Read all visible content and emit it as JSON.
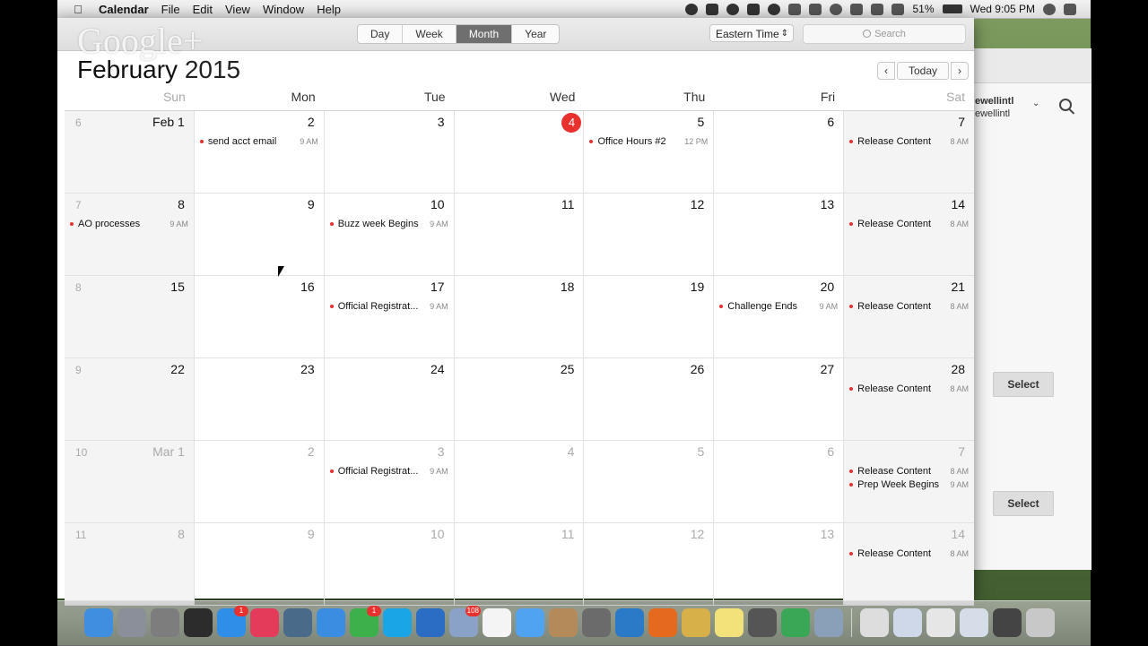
{
  "menubar": {
    "app_name": "Calendar",
    "menus": [
      "File",
      "Edit",
      "View",
      "Window",
      "Help"
    ],
    "battery": "51%",
    "clock": "Wed 9:05 PM"
  },
  "watermark": "Google+",
  "toolbar": {
    "views": [
      "Day",
      "Week",
      "Month",
      "Year"
    ],
    "active_view": "Month",
    "timezone": "Eastern Time",
    "search_placeholder": "Search"
  },
  "title": {
    "month": "February",
    "year": "2015"
  },
  "nav": {
    "prev": "‹",
    "today": "Today",
    "next": "›"
  },
  "weekdays": [
    "Sun",
    "Mon",
    "Tue",
    "Wed",
    "Thu",
    "Fri",
    "Sat"
  ],
  "weeks": [
    {
      "weeknum": "6",
      "days": [
        {
          "label": "Feb 1",
          "dim": false,
          "events": []
        },
        {
          "label": "2",
          "dim": false,
          "events": [
            {
              "title": "send acct email",
              "time": "9 AM"
            }
          ]
        },
        {
          "label": "3",
          "dim": false,
          "events": []
        },
        {
          "label": "4",
          "dim": false,
          "today": true,
          "events": []
        },
        {
          "label": "5",
          "dim": false,
          "events": [
            {
              "title": "Office Hours #2",
              "time": "12 PM"
            }
          ]
        },
        {
          "label": "6",
          "dim": false,
          "events": []
        },
        {
          "label": "7",
          "dim": false,
          "events": [
            {
              "title": "Release Content",
              "time": "8 AM"
            }
          ]
        }
      ]
    },
    {
      "weeknum": "7",
      "days": [
        {
          "label": "8",
          "dim": false,
          "events": [
            {
              "title": "AO processes",
              "time": "9 AM"
            }
          ]
        },
        {
          "label": "9",
          "dim": false,
          "events": []
        },
        {
          "label": "10",
          "dim": false,
          "events": [
            {
              "title": "Buzz week Begins",
              "time": "9 AM"
            }
          ]
        },
        {
          "label": "11",
          "dim": false,
          "events": []
        },
        {
          "label": "12",
          "dim": false,
          "events": []
        },
        {
          "label": "13",
          "dim": false,
          "events": []
        },
        {
          "label": "14",
          "dim": false,
          "events": [
            {
              "title": "Release Content",
              "time": "8 AM"
            }
          ]
        }
      ]
    },
    {
      "weeknum": "8",
      "days": [
        {
          "label": "15",
          "dim": false,
          "events": []
        },
        {
          "label": "16",
          "dim": false,
          "events": []
        },
        {
          "label": "17",
          "dim": false,
          "events": [
            {
              "title": "Official Registrat...",
              "time": "9 AM"
            }
          ]
        },
        {
          "label": "18",
          "dim": false,
          "events": []
        },
        {
          "label": "19",
          "dim": false,
          "events": []
        },
        {
          "label": "20",
          "dim": false,
          "events": [
            {
              "title": "Challenge Ends",
              "time": "9 AM"
            }
          ]
        },
        {
          "label": "21",
          "dim": false,
          "events": [
            {
              "title": "Release Content",
              "time": "8 AM"
            }
          ]
        }
      ]
    },
    {
      "weeknum": "9",
      "days": [
        {
          "label": "22",
          "dim": false,
          "events": []
        },
        {
          "label": "23",
          "dim": false,
          "events": []
        },
        {
          "label": "24",
          "dim": false,
          "events": []
        },
        {
          "label": "25",
          "dim": false,
          "events": []
        },
        {
          "label": "26",
          "dim": false,
          "events": []
        },
        {
          "label": "27",
          "dim": false,
          "events": []
        },
        {
          "label": "28",
          "dim": false,
          "events": [
            {
              "title": "Release Content",
              "time": "8 AM"
            }
          ]
        }
      ]
    },
    {
      "weeknum": "10",
      "days": [
        {
          "label": "Mar 1",
          "dim": true,
          "events": []
        },
        {
          "label": "2",
          "dim": true,
          "events": []
        },
        {
          "label": "3",
          "dim": true,
          "events": [
            {
              "title": "Official Registrat...",
              "time": "9 AM"
            }
          ]
        },
        {
          "label": "4",
          "dim": true,
          "events": []
        },
        {
          "label": "5",
          "dim": true,
          "events": []
        },
        {
          "label": "6",
          "dim": true,
          "events": []
        },
        {
          "label": "7",
          "dim": true,
          "events": [
            {
              "title": "Release Content",
              "time": "8 AM"
            },
            {
              "title": "Prep Week Begins",
              "time": "9 AM"
            }
          ]
        }
      ]
    },
    {
      "weeknum": "11",
      "days": [
        {
          "label": "8",
          "dim": true,
          "events": []
        },
        {
          "label": "9",
          "dim": true,
          "events": []
        },
        {
          "label": "10",
          "dim": true,
          "events": []
        },
        {
          "label": "11",
          "dim": true,
          "events": []
        },
        {
          "label": "12",
          "dim": true,
          "events": []
        },
        {
          "label": "13",
          "dim": true,
          "events": []
        },
        {
          "label": "14",
          "dim": true,
          "events": [
            {
              "title": "Release Content",
              "time": "8 AM"
            }
          ]
        }
      ]
    }
  ],
  "background_window": {
    "account_line1": "ewellintl",
    "account_line2": "ewellintl",
    "select_label_1": "Select",
    "select_label_2": "Select"
  },
  "dock": {
    "apps": [
      {
        "name": "finder-icon",
        "color": "#3f8ee0"
      },
      {
        "name": "launchpad-icon",
        "color": "#8a8f99"
      },
      {
        "name": "system-preferences-icon",
        "color": "#7d7d7d"
      },
      {
        "name": "activity-monitor-icon",
        "color": "#2c2c2c"
      },
      {
        "name": "app-store-icon",
        "color": "#2f8fe8",
        "badge": "1"
      },
      {
        "name": "itunes-icon",
        "color": "#e53b5b"
      },
      {
        "name": "preview-icon",
        "color": "#4a6a8a"
      },
      {
        "name": "safari-icon",
        "color": "#3a8de0"
      },
      {
        "name": "facetime-icon",
        "color": "#3cb04a",
        "badge": "1"
      },
      {
        "name": "skype-icon",
        "color": "#19a5e6"
      },
      {
        "name": "word-icon",
        "color": "#2b6cc4"
      },
      {
        "name": "mail-icon",
        "color": "#8aa2c8",
        "badge": "108"
      },
      {
        "name": "calendar-icon",
        "color": "#f4f4f4"
      },
      {
        "name": "messages-icon",
        "color": "#4fa3f0"
      },
      {
        "name": "contacts-icon",
        "color": "#b58a5a"
      },
      {
        "name": "calculator-icon",
        "color": "#6b6b6b"
      },
      {
        "name": "xcode-icon",
        "color": "#2a7ac8"
      },
      {
        "name": "firefox-icon",
        "color": "#e66a1e"
      },
      {
        "name": "photos-icon",
        "color": "#d8b04a"
      },
      {
        "name": "notes-icon",
        "color": "#f3e27a"
      },
      {
        "name": "remote-desktop-icon",
        "color": "#555"
      },
      {
        "name": "chrome-icon",
        "color": "#3aa757"
      },
      {
        "name": "image-capture-icon",
        "color": "#8aa0b8"
      }
    ],
    "stacks": [
      {
        "name": "stack-document-1-icon",
        "color": "#ddd"
      },
      {
        "name": "stack-document-2-icon",
        "color": "#cfd8e8"
      },
      {
        "name": "stack-document-3-icon",
        "color": "#e6e6e6"
      },
      {
        "name": "stack-document-4-icon",
        "color": "#d5dde8"
      },
      {
        "name": "stack-document-5-icon",
        "color": "#444"
      },
      {
        "name": "trash-icon",
        "color": "#c8c8c8"
      }
    ]
  }
}
